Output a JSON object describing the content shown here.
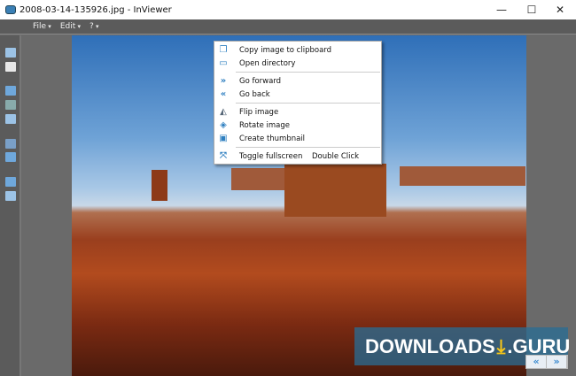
{
  "window": {
    "title": "2008-03-14-135926.jpg - InViewer",
    "minimize": "—",
    "maximize": "☐",
    "close": "✕"
  },
  "menubar": [
    "File",
    "Edit",
    "?"
  ],
  "context_menu": {
    "items": [
      {
        "label": "Copy image to clipboard",
        "icon": "copy-icon"
      },
      {
        "label": "Open directory",
        "icon": "folder-icon"
      },
      {
        "label": "Go forward",
        "icon": "forward-icon"
      },
      {
        "label": "Go back",
        "icon": "back-icon"
      },
      {
        "label": "Flip image",
        "icon": "flip-icon"
      },
      {
        "label": "Rotate image",
        "icon": "rotate-icon"
      },
      {
        "label": "Create thumbnail",
        "icon": "thumbnail-icon"
      },
      {
        "label": "Toggle fullscreen",
        "icon": "fullscreen-icon",
        "shortcut": "Double Click"
      }
    ]
  },
  "watermark": {
    "text": "DOWNLOADS",
    "suffix": ".GURU"
  },
  "nav": {
    "back": "«",
    "forward": "»"
  }
}
